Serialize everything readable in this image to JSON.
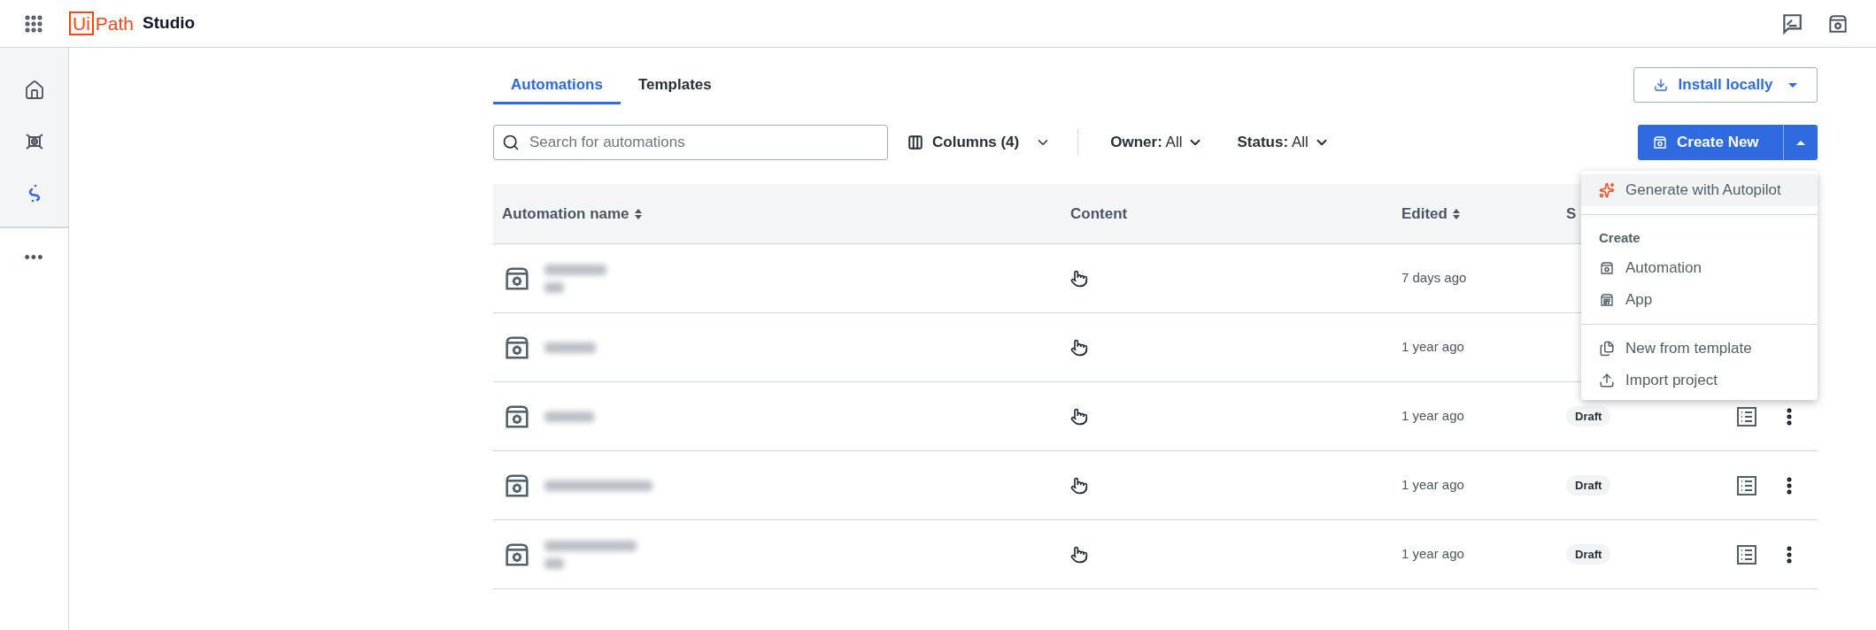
{
  "header": {
    "logo": {
      "boxed": "Ui",
      "rest": "Path"
    },
    "product": "Studio"
  },
  "sidebar": {
    "items": [
      {
        "kind": "home",
        "selected": false
      },
      {
        "kind": "robot",
        "selected": false
      },
      {
        "kind": "studio",
        "selected": true
      }
    ],
    "more": "•••"
  },
  "tabs": [
    {
      "label": "Automations",
      "selected": true
    },
    {
      "label": "Templates",
      "selected": false
    }
  ],
  "install_button": "Install locally",
  "search": {
    "placeholder": "Search for automations"
  },
  "columns_button": "Columns (4)",
  "filters": [
    "**Owner:** All",
    "**Status:** All"
  ],
  "create_button": "Create New",
  "table": {
    "columns": [
      "Automation name",
      "Content",
      "Edited",
      "S"
    ],
    "rows": [
      {
        "subtitle": true,
        "edited": "7 days ago"
      },
      {
        "subtitle": false,
        "edited": "1 year ago"
      },
      {
        "subtitle": false,
        "edited": "1 year ago",
        "status": "Draft"
      },
      {
        "subtitle": false,
        "edited": "1 year ago",
        "status": "Draft"
      },
      {
        "subtitle": true,
        "edited": "1 year ago",
        "status": "Draft"
      }
    ]
  },
  "menu": {
    "items": [
      {
        "kind": "autopilot",
        "label": "Generate with Autopilot",
        "selected": true
      },
      {
        "kind": "divider"
      },
      {
        "kind": "heading",
        "label": "Create"
      },
      {
        "kind": "automation",
        "label": "Automation",
        "selected": false
      },
      {
        "kind": "app",
        "label": "App",
        "selected": false
      },
      {
        "kind": "divider"
      },
      {
        "kind": "template",
        "label": "New from template",
        "selected": false
      },
      {
        "kind": "import",
        "label": "Import project",
        "selected": false
      }
    ]
  }
}
